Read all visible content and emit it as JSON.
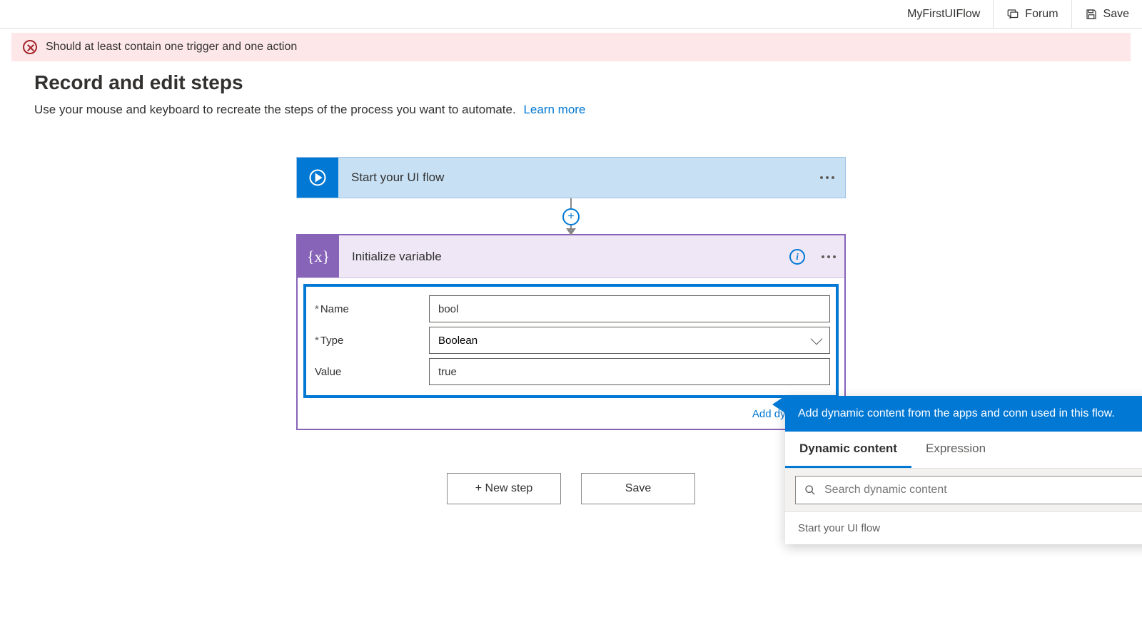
{
  "topbar": {
    "flow_name": "MyFirstUIFlow",
    "forum_label": "Forum",
    "save_label": "Save"
  },
  "warning": {
    "message": "Should at least contain one trigger and one action"
  },
  "header": {
    "title": "Record and edit steps",
    "description": "Use your mouse and keyboard to recreate the steps of the process you want to automate.",
    "learn_more": "Learn more"
  },
  "flow": {
    "start_label": "Start your UI flow",
    "init_var": {
      "title": "Initialize variable",
      "fields": {
        "name_label": "Name",
        "name_value": "bool",
        "type_label": "Type",
        "type_value": "Boolean",
        "value_label": "Value",
        "value_value": "true"
      },
      "add_dynamic_label": "Add dynamic con"
    }
  },
  "buttons": {
    "new_step": "+ New step",
    "save": "Save"
  },
  "dynamic_panel": {
    "header_line": "Add dynamic content from the apps and conn used in this flow.",
    "tab_dynamic": "Dynamic content",
    "tab_expression": "Expression",
    "search_placeholder": "Search dynamic content",
    "section_label": "Start your UI flow"
  }
}
